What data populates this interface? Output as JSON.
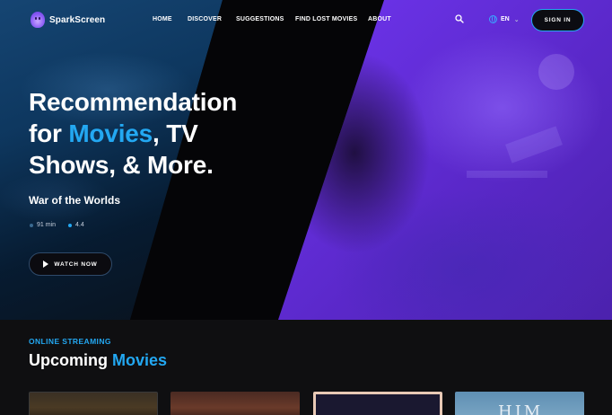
{
  "brand": {
    "name": "SparkScreen"
  },
  "nav": {
    "links": [
      "HOME",
      "DISCOVER",
      "SUGGESTIONS",
      "FIND LOST MOVIES",
      "ABOUT"
    ],
    "language": "EN",
    "signin_label": "SIGN IN"
  },
  "hero": {
    "title_line1": "Recommendation",
    "title_for": "for ",
    "title_accent": "Movies",
    "title_rest": ", TV",
    "title_line3": "Shows, & More.",
    "movie_title": "War of the Worlds",
    "duration": "91 min",
    "rating": "4.4",
    "watch_label": "WATCH NOW"
  },
  "section": {
    "eyebrow": "ONLINE STREAMING",
    "title_plain": "Upcoming ",
    "title_accent": "Movies",
    "cards": [
      {
        "text": ""
      },
      {
        "text": ""
      },
      {
        "text": ""
      },
      {
        "text": "HIM"
      }
    ]
  },
  "colors": {
    "accent": "#23a8f2",
    "purple": "#5b2bd8",
    "background": "#0d0d0f"
  },
  "icons": [
    "search-icon",
    "globe-icon",
    "chevron-down-icon",
    "play-icon",
    "clock-icon",
    "star-icon"
  ]
}
